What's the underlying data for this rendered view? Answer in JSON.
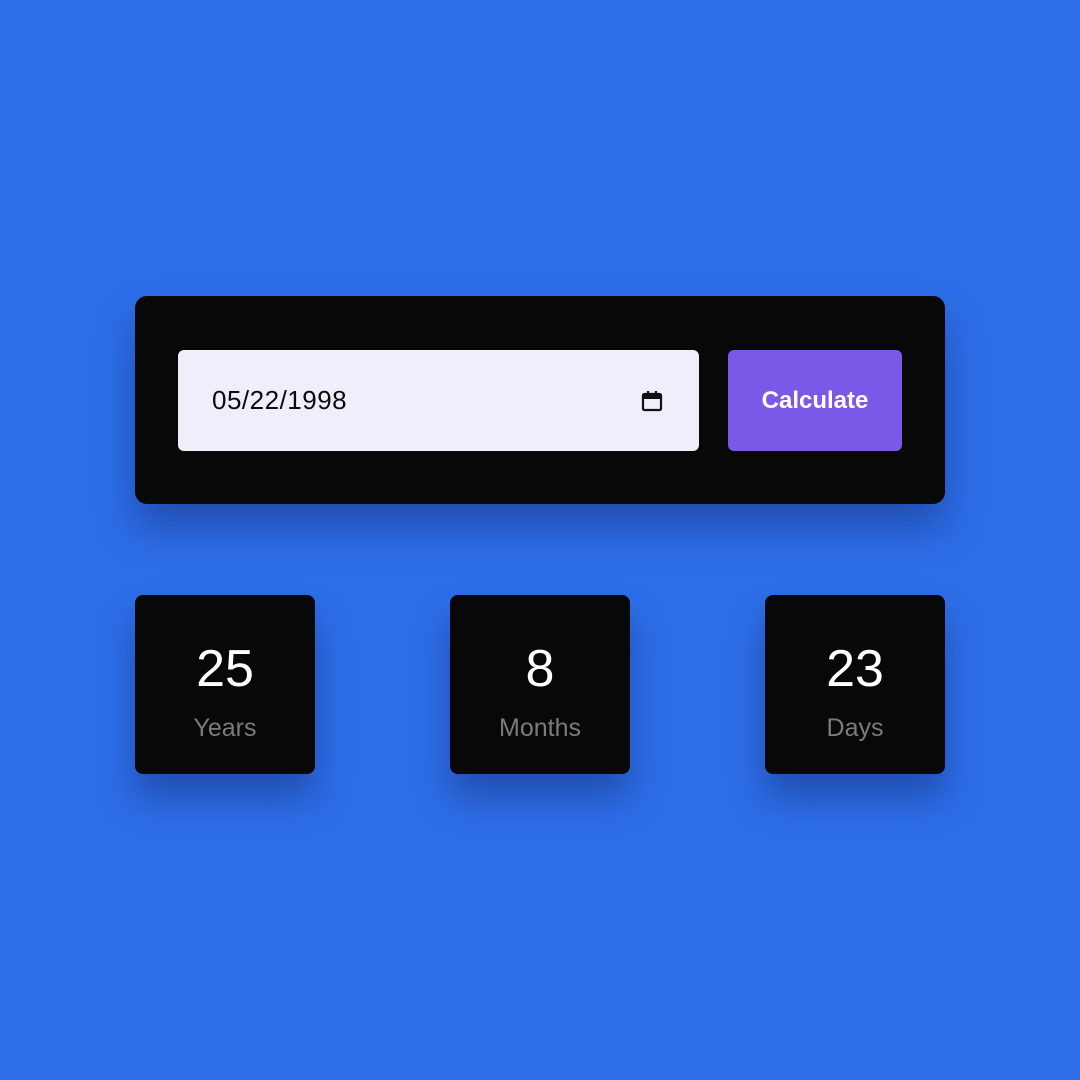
{
  "colors": {
    "background": "#2d6ee8",
    "card": "#080808",
    "input_bg": "#efeffb",
    "button": "#7a58e8",
    "label_gray": "#7b7b7b"
  },
  "date_input": {
    "value": "05/22/1998",
    "icon": "calendar-icon"
  },
  "calculate_button": {
    "label": "Calculate"
  },
  "results": {
    "years": {
      "value": "25",
      "label": "Years"
    },
    "months": {
      "value": "8",
      "label": "Months"
    },
    "days": {
      "value": "23",
      "label": "Days"
    }
  }
}
